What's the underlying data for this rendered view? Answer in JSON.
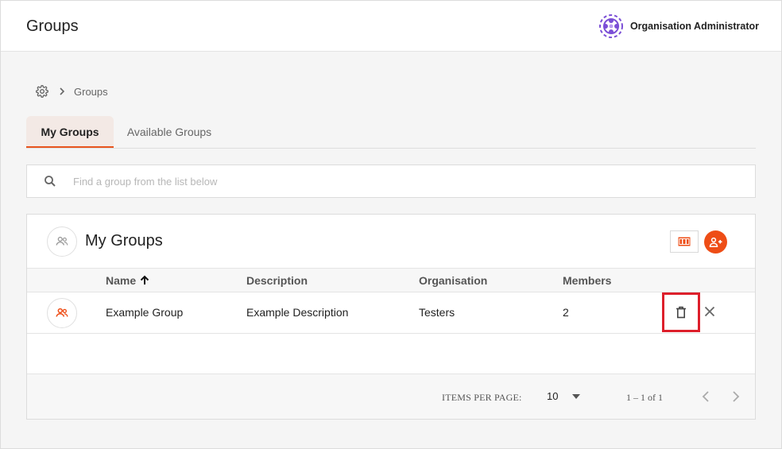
{
  "header": {
    "title": "Groups",
    "user_name": "Organisation Administrator",
    "logo_icon": "org-logo-icon"
  },
  "breadcrumb": {
    "root_icon": "gear-icon",
    "separator_icon": "chevron-right-icon",
    "current": "Groups"
  },
  "tabs": [
    {
      "label": "My Groups",
      "active": true
    },
    {
      "label": "Available Groups",
      "active": false
    }
  ],
  "search": {
    "placeholder": "Find a group from the list below",
    "value": "",
    "icon": "search-icon"
  },
  "panel": {
    "title": "My Groups",
    "icon": "group-icon",
    "actions": [
      "columns-icon",
      "add-group-icon"
    ]
  },
  "table": {
    "columns": [
      "Name",
      "Description",
      "Organisation",
      "Members"
    ],
    "sort_column": "Name",
    "sort_direction": "ascending",
    "rows": [
      {
        "name": "Example Group",
        "description": "Example Description",
        "organisation": "Testers",
        "members": "2"
      }
    ]
  },
  "paginator": {
    "items_per_page_label": "ITEMS PER PAGE:",
    "items_per_page": "10",
    "range": "1 – 1 of 1"
  },
  "colors": {
    "accent": "#ee4d16",
    "highlight": "#dd1f2b",
    "logo": "#7b4fd6"
  }
}
